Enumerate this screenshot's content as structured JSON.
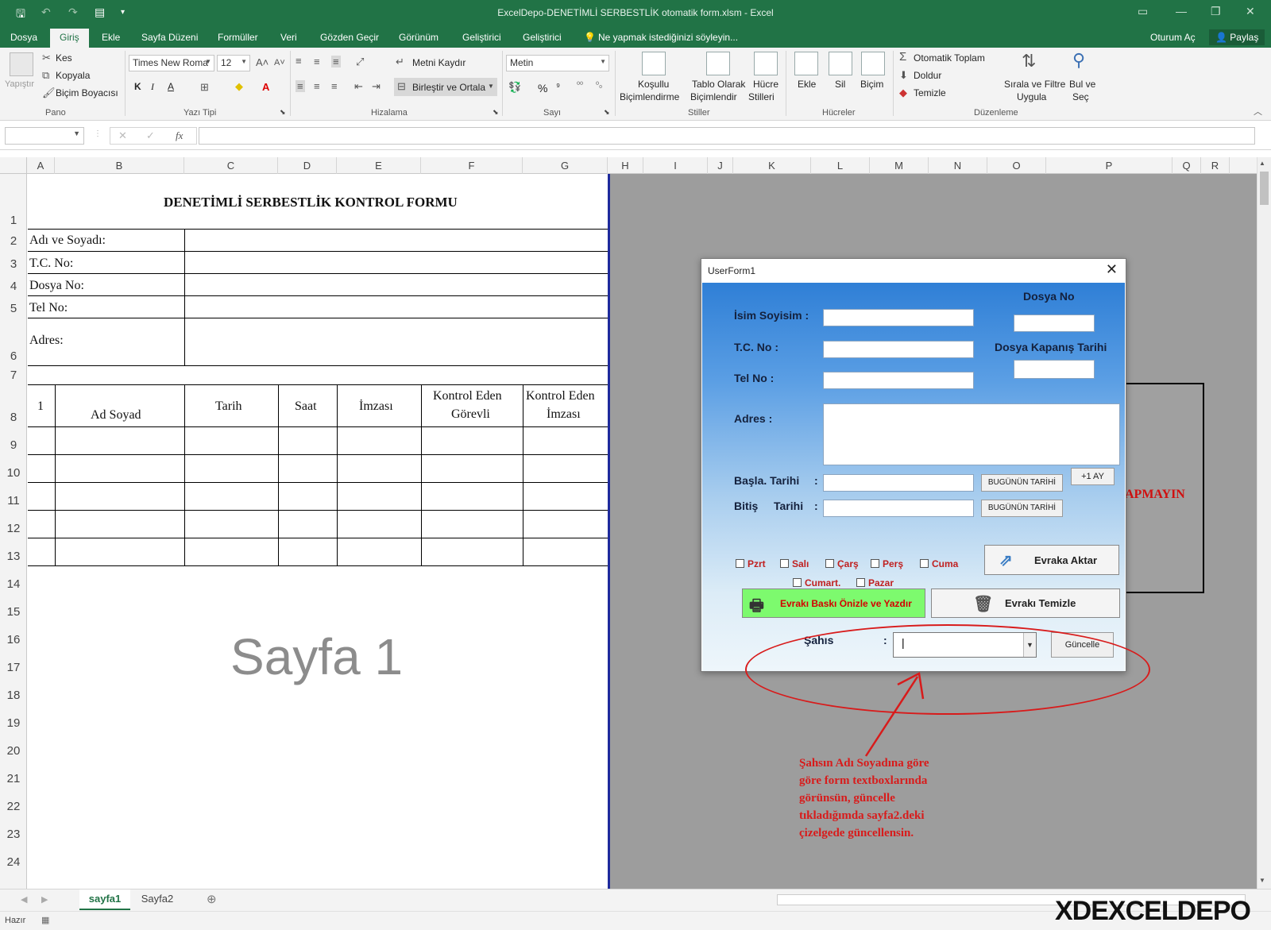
{
  "window": {
    "title": "ExcelDepo-DENETİMLİ SERBESTLİK otomatik form.xlsm - Excel"
  },
  "tabs": [
    "Dosya",
    "Giriş",
    "Ekle",
    "Sayfa Düzeni",
    "Formüller",
    "Veri",
    "Gözden Geçir",
    "Görünüm",
    "Geliştirici",
    "Geliştirici"
  ],
  "tell_me": "Ne yapmak istediğinizi söyleyin...",
  "account": {
    "signin": "Oturum Aç",
    "share": "Paylaş"
  },
  "ribbon": {
    "pano": {
      "paste": "Yapıştır",
      "cut": "Kes",
      "copy": "Kopyala",
      "painter": "Biçim Boyacısı",
      "label": "Pano"
    },
    "font": {
      "name": "Times New Roma",
      "size": "12",
      "bold": "K",
      "italic": "I",
      "underline": "A",
      "label": "Yazı Tipi"
    },
    "align": {
      "wrap": "Metni Kaydır",
      "merge": "Birleştir ve Ortala",
      "label": "Hizalama"
    },
    "number": {
      "format": "Metin",
      "percent": "%",
      "comma": "⁹",
      "label": "Sayı"
    },
    "styles": {
      "cond1": "Koşullu",
      "cond2": "Biçimlendirme",
      "table1": "Tablo Olarak",
      "table2": "Biçimlendir",
      "cell1": "Hücre",
      "cell2": "Stilleri",
      "label": "Stiller"
    },
    "cells": {
      "insert": "Ekle",
      "delete": "Sil",
      "format": "Biçim",
      "label": "Hücreler"
    },
    "editing": {
      "autosum": "Otomatik Toplam",
      "fill": "Doldur",
      "clear": "Temizle",
      "sort1": "Sırala ve Filtre",
      "sort2": "Uygula",
      "find1": "Bul ve",
      "find2": "Seç",
      "label": "Düzenleme"
    }
  },
  "columns": [
    "A",
    "B",
    "C",
    "D",
    "E",
    "F",
    "G",
    "H",
    "I",
    "J",
    "K",
    "L",
    "M",
    "N",
    "O",
    "P",
    "Q",
    "R"
  ],
  "rows": [
    "1",
    "2",
    "3",
    "4",
    "5",
    "6",
    "7",
    "8",
    "9",
    "10",
    "11",
    "12",
    "13",
    "14",
    "15",
    "16",
    "17",
    "18",
    "19",
    "20",
    "21",
    "22",
    "23",
    "24"
  ],
  "sheet": {
    "title": "DENETİMLİ SERBESTLİK KONTROL FORMU",
    "labels": [
      "Adı ve Soyadı:",
      "T.C. No:",
      "Dosya No:",
      "Tel No:",
      "Adres:"
    ],
    "table_headers": {
      "num": "1",
      "name": "Ad Soyad",
      "date": "Tarih",
      "time": "Saat",
      "sign": "İmzası",
      "officer1": "Kontrol Eden",
      "officer2": "Görevli",
      "osign1": "Kontrol Eden",
      "osign2": "İmzası"
    },
    "watermark": "Sayfa 1",
    "bg_text": "APMAYIN"
  },
  "userform": {
    "title": "UserForm1",
    "close": "✕",
    "labels": {
      "name": "İsim Soyisim :",
      "tc": "T.C. No :",
      "tel": "Tel No :",
      "address": "Adres :",
      "start": "Başla. Tarihi",
      "end": "Bitiş",
      "end2": "Tarihi",
      "colon": ":",
      "file_no": "Dosya No",
      "close_date": "Dosya Kapanış Tarihi",
      "person": "Şahıs"
    },
    "buttons": {
      "today1": "BUGÜNÜN TARİHİ",
      "today2": "BUGÜNÜN TARİHİ",
      "plus_month": "+1 AY",
      "transfer": "Evraka Aktar",
      "print": "Evrakı Baskı Önizle ve Yazdır",
      "clear": "Evrakı Temizle",
      "update": "Güncelle"
    },
    "days": [
      "Pzrt",
      "Salı",
      "Çarş",
      "Perş",
      "Cuma",
      "Cumart.",
      "Pazar"
    ]
  },
  "annotation": {
    "line1": "Şahsın Adı Soyadına göre",
    "line2": "göre form textboxlarında",
    "line3": "görünsün, güncelle",
    "line4": "tıkladığımda sayfa2.deki",
    "line5": "çizelgede güncellensin."
  },
  "sheet_tabs": [
    "sayfa1",
    "Sayfa2"
  ],
  "status": {
    "ready": "Hazır"
  },
  "logo": {
    "text": "XDEXCELDEPO"
  },
  "colors": {
    "excel_green": "#217346",
    "annotation_red": "#d81b1b",
    "print_button_green": "#7dfa6e"
  }
}
